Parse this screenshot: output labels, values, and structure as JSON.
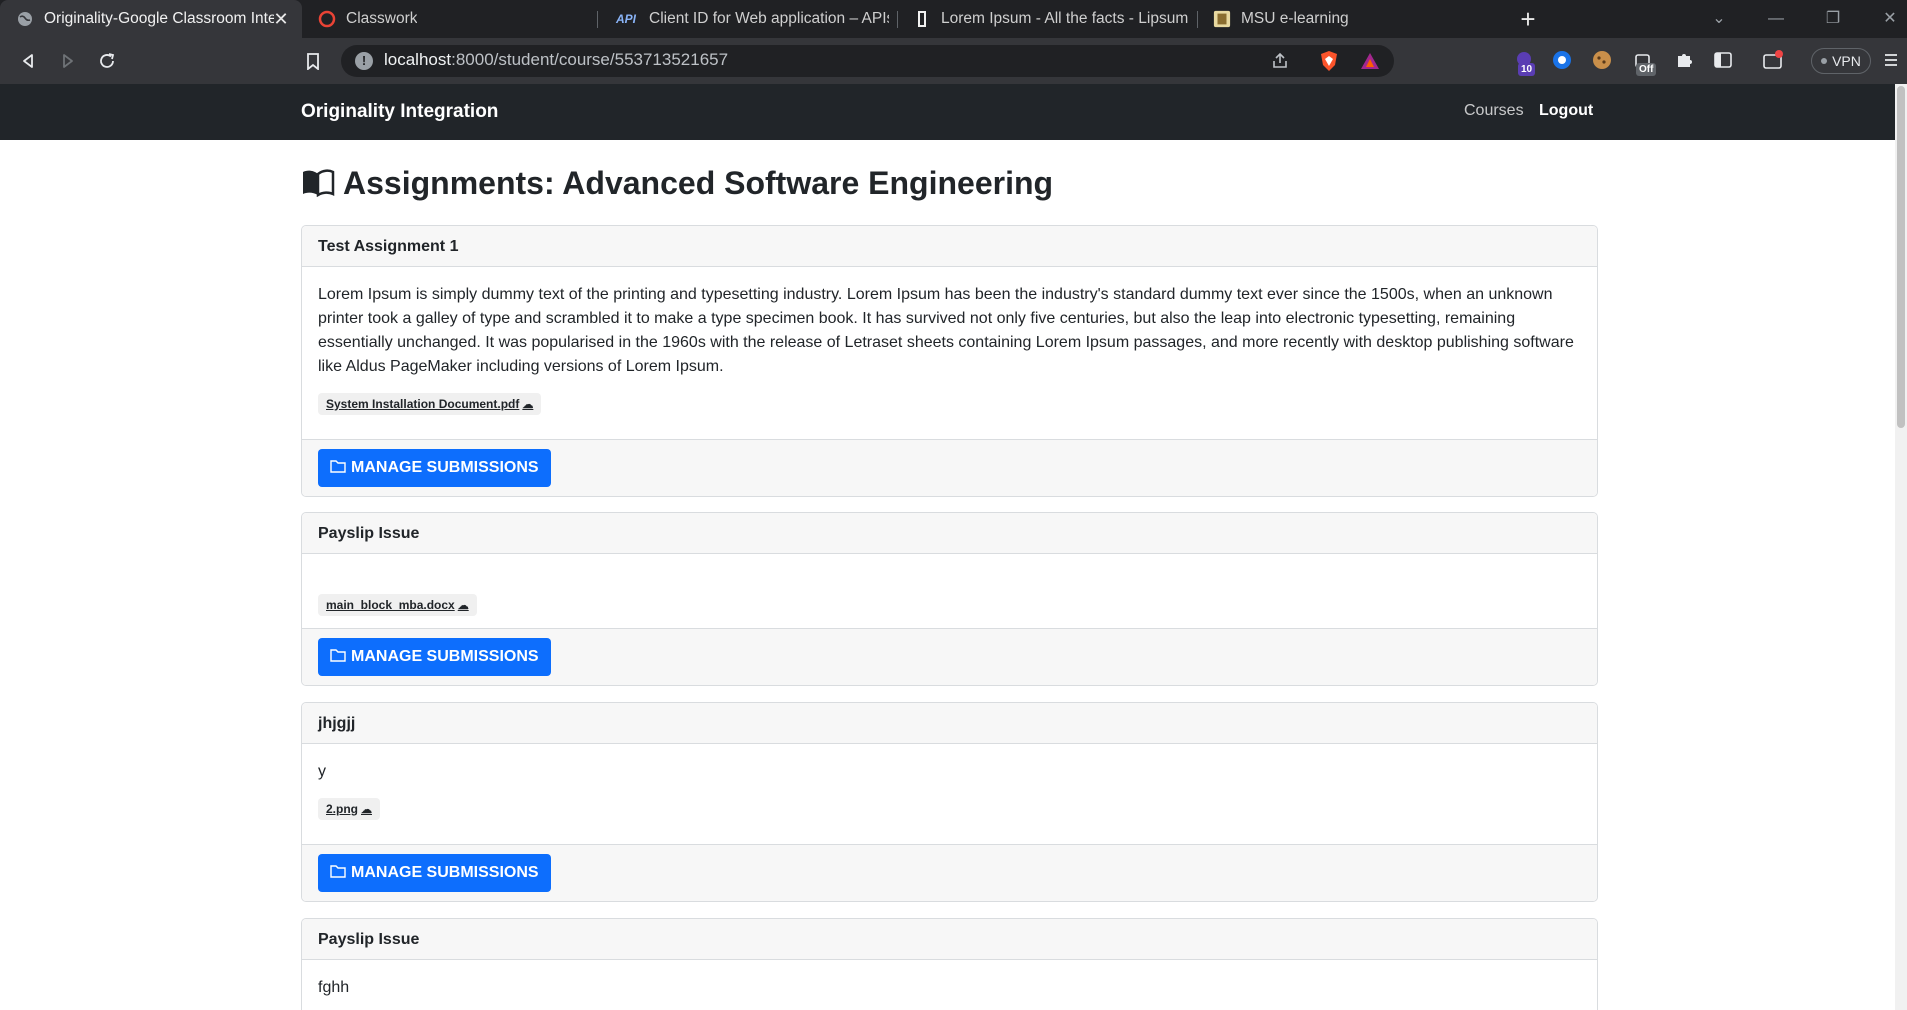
{
  "browser": {
    "tabs": [
      {
        "title": "Originality-Google Classroom Inte",
        "active": true,
        "icon": "globe-icon"
      },
      {
        "title": "Classwork",
        "active": false,
        "icon": "google-classroom-icon"
      },
      {
        "title": "Client ID for Web application – APIs &",
        "active": false,
        "icon": "api-icon"
      },
      {
        "title": "Lorem Ipsum - All the facts - Lipsum g",
        "active": false,
        "icon": "lipsum-icon"
      },
      {
        "title": "MSU e-learning",
        "active": false,
        "icon": "msu-icon"
      }
    ],
    "api_icon_text": "API",
    "url_host": "localhost",
    "url_path": ":8000/student/course/553713521657",
    "extension_badge": "10",
    "extension_badge_off": "Off",
    "vpn_label": "VPN"
  },
  "navbar": {
    "brand": "Originality Integration",
    "courses": "Courses",
    "logout": "Logout"
  },
  "page": {
    "title": "Assignments: Advanced Software Engineering"
  },
  "assignments": [
    {
      "title": "Test Assignment 1",
      "description": "Lorem Ipsum is simply dummy text of the printing and typesetting industry. Lorem Ipsum has been the industry's standard dummy text ever since the 1500s, when an unknown printer took a galley of type and scrambled it to make a type specimen book. It has survived not only five centuries, but also the leap into electronic typesetting, remaining essentially unchanged. It was popularised in the 1960s with the release of Letraset sheets containing Lorem Ipsum passages, and more recently with desktop publishing software like Aldus PageMaker including versions of Lorem Ipsum.",
      "attachment": "System Installation Document.pdf",
      "button": "MANAGE SUBMISSIONS"
    },
    {
      "title": "Payslip Issue",
      "description": "",
      "attachment": "main_block_mba.docx",
      "button": "MANAGE SUBMISSIONS"
    },
    {
      "title": "jhjgjj",
      "description": "y",
      "attachment": "2.png",
      "button": "MANAGE SUBMISSIONS"
    },
    {
      "title": "Payslip Issue",
      "description": "fghh"
    }
  ],
  "colors": {
    "navbar_bg": "#212529",
    "primary_button": "#0d6efd",
    "card_header_bg": "#f7f7f7"
  }
}
